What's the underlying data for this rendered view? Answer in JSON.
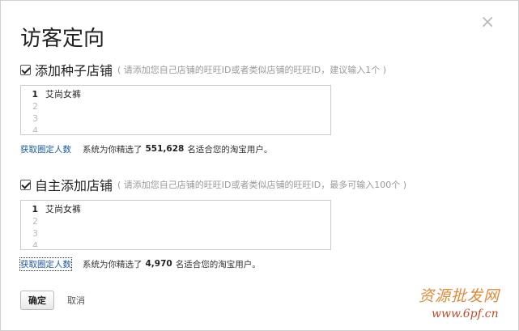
{
  "dialog": {
    "title": "访客定向",
    "close_glyph": "×"
  },
  "sections": [
    {
      "label": "添加种子店铺",
      "hint": "( 请添加您自己店铺的旺旺ID或者类似店铺的旺旺ID，建议输入1个 )",
      "checked": true,
      "editor": {
        "lines": [
          {
            "num": "1",
            "text": "艾尚女裤"
          },
          {
            "num": "2",
            "text": ""
          },
          {
            "num": "3",
            "text": ""
          },
          {
            "num": "4",
            "text": ""
          }
        ]
      },
      "link": "获取圈定人数",
      "stats_prefix": "系统为你精选了",
      "stats_count": "551,628",
      "stats_suffix": "名适合您的淘宝用户。"
    },
    {
      "label": "自主添加店铺",
      "hint": "( 请添加您自己店铺的旺旺ID或者类似店铺的旺旺ID，最多可输入100个 )",
      "checked": true,
      "editor": {
        "lines": [
          {
            "num": "1",
            "text": "艾尚女裤"
          },
          {
            "num": "2",
            "text": ""
          },
          {
            "num": "3",
            "text": ""
          },
          {
            "num": "4",
            "text": ""
          }
        ]
      },
      "link": "获取圈定人数",
      "stats_prefix": "系统为你精选了",
      "stats_count": "4,970",
      "stats_suffix": "名适合您的淘宝用户。"
    }
  ],
  "actions": {
    "confirm": "确定",
    "cancel": "取消"
  },
  "watermark": {
    "line1": "资源批发网",
    "line2": "www.6pf.cn"
  }
}
